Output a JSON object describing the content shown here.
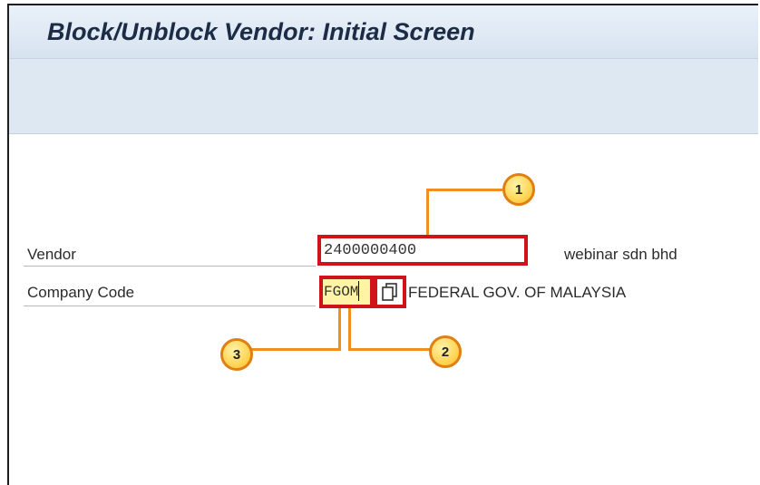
{
  "header": {
    "title": "Block/Unblock Vendor:  Initial Screen"
  },
  "form": {
    "vendor": {
      "label": "Vendor",
      "value": "2400000400",
      "description": "webinar sdn bhd"
    },
    "company_code": {
      "label": "Company Code",
      "value": "FGOM",
      "description": "FEDERAL GOV. OF MALAYSIA",
      "help_icon": "possible-entries-icon"
    }
  },
  "callouts": [
    {
      "number": "1"
    },
    {
      "number": "2"
    },
    {
      "number": "3"
    }
  ],
  "colors": {
    "highlight": "#d0121b",
    "callout_line": "#f0901e",
    "badge_fill": "#ffd04a",
    "title_text": "#1c2b46"
  }
}
